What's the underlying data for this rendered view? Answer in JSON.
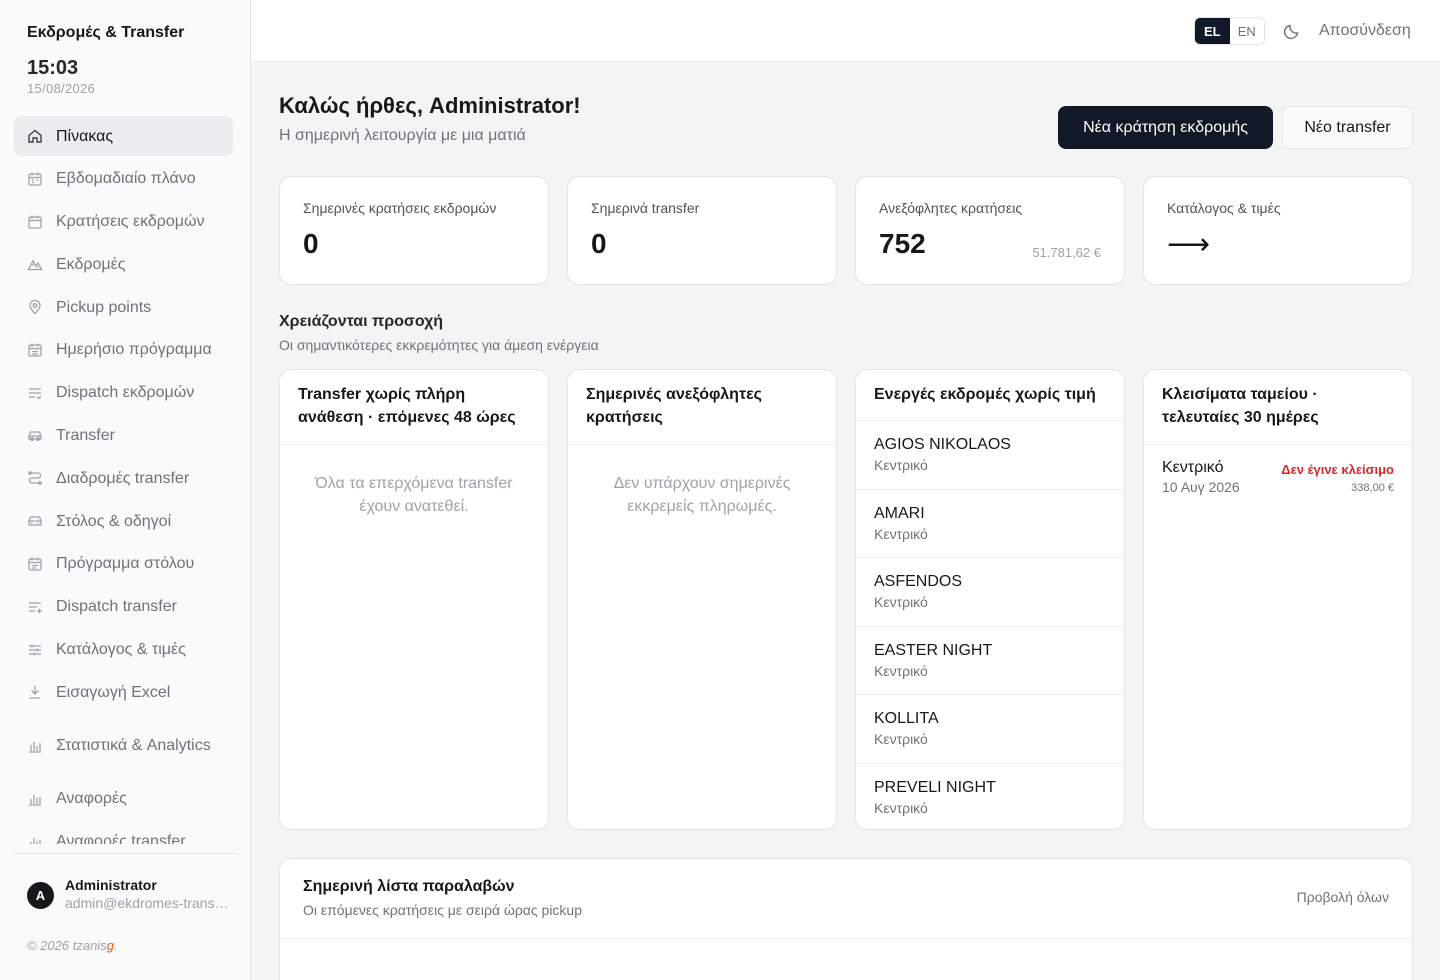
{
  "sidebar": {
    "brand": "Εκδρομές & Transfer",
    "time": "15:03",
    "date": "15/08/2026",
    "items": [
      {
        "label": "Πίνακας",
        "icon": "home-icon",
        "active": true
      },
      {
        "label": "Εβδομαδιαίο πλάνο",
        "icon": "calendar-icon"
      },
      {
        "label": "Κρατήσεις εκδρομών",
        "icon": "calendar-icon"
      },
      {
        "label": "Εκδρομές",
        "icon": "mountain-icon"
      },
      {
        "label": "Pickup points",
        "icon": "map-pin-icon"
      },
      {
        "label": "Ημερήσιο πρόγραμμα",
        "icon": "calendar-icon"
      },
      {
        "label": "Dispatch εκδρομών",
        "icon": "list-check-icon"
      },
      {
        "label": "Transfer",
        "icon": "car-icon"
      },
      {
        "label": "Διαδρομές transfer",
        "icon": "route-icon"
      },
      {
        "label": "Στόλος & οδηγοί",
        "icon": "car-icon"
      },
      {
        "label": "Πρόγραμμα στόλου",
        "icon": "calendar-icon"
      },
      {
        "label": "Dispatch transfer",
        "icon": "list-plus-icon"
      },
      {
        "label": "Κατάλογος & τιμές",
        "icon": "sliders-icon"
      },
      {
        "label": "Εισαγωγή Excel",
        "icon": "download-icon"
      },
      {
        "label": "Στατιστικά & Analytics",
        "icon": "bar-chart-icon"
      },
      {
        "label": "Αναφορές",
        "icon": "bar-chart-icon"
      },
      {
        "label": "Αναφορές transfer",
        "icon": "bar-chart-icon"
      }
    ],
    "user": {
      "initial": "A",
      "name": "Administrator",
      "email": "admin@ekdromes-transfer.gr"
    },
    "copyright": "© 2026 tzanis",
    "copyright_mark": "g",
    "copyright_end": "."
  },
  "header": {
    "lang_el": "EL",
    "lang_en": "EN",
    "theme_icon": "moon-icon",
    "logout": "Αποσύνδεση"
  },
  "main": {
    "welcome": "Καλώς ήρθες, Administrator!",
    "subtitle": "Η σημερινή λειτουργία με μια ματιά",
    "new_excursion_booking": "Νέα κράτηση εκδρομής",
    "new_transfer": "Νέο transfer",
    "stats": [
      {
        "label": "Σημερινές κρατήσεις εκδρομών",
        "value": "0"
      },
      {
        "label": "Σημερινά transfer",
        "value": "0"
      },
      {
        "label": "Ανεξόφλητες κρατήσεις",
        "value": "752",
        "aside": "51.781,62 €"
      },
      {
        "label": "Κατάλογος & τιμές",
        "value": "⟶"
      }
    ],
    "attention_title": "Χρειάζονται προσοχή",
    "attention_sub": "Οι σημαντικότερες εκκρεμότητες για άμεση ενέργεια",
    "panels": {
      "transfers": {
        "title": "Transfer χωρίς πλήρη ανάθεση · επόμενες 48 ώρες",
        "empty": "Όλα τα επερχόμενα transfer έχουν ανατεθεί."
      },
      "unpaid": {
        "title": "Σημερινές ανεξόφλητες κρατήσεις",
        "empty": "Δεν υπάρχουν σημερινές εκκρεμείς πληρωμές."
      },
      "no_price": {
        "title": "Ενεργές εκδρομές χωρίς τιμή",
        "items": [
          {
            "name": "AGIOS NIKOLAOS",
            "sub": "Κεντρικό"
          },
          {
            "name": "AMARI",
            "sub": "Κεντρικό"
          },
          {
            "name": "ASFENDOS",
            "sub": "Κεντρικό"
          },
          {
            "name": "EASTER NIGHT",
            "sub": "Κεντρικό"
          },
          {
            "name": "KOLLITA",
            "sub": "Κεντρικό"
          },
          {
            "name": "PREVELI NIGHT",
            "sub": "Κεντρικό"
          }
        ]
      },
      "cash": {
        "title": "Κλεισίματα ταμείου · τελευταίες 30 ημέρες",
        "rows": [
          {
            "name": "Κεντρικό",
            "date": "10 Αυγ 2026",
            "status": "Δεν έγινε κλείσιμο",
            "amount": "338,00 €"
          }
        ]
      }
    },
    "pickups": {
      "title": "Σημερινή λίστα παραλαβών",
      "sub": "Οι επόμενες κρατήσεις με σειρά ώρας pickup",
      "view_all": "Προβολή όλων"
    }
  }
}
